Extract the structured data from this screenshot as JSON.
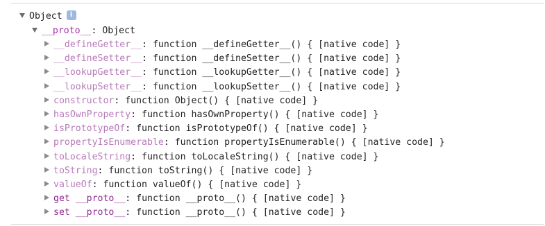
{
  "root": {
    "label": "Object",
    "info_icon": "i"
  },
  "proto": {
    "key": "__proto__",
    "value": "Object"
  },
  "properties": [
    {
      "key": "__defineGetter__",
      "value": "function __defineGetter__() { [native code] }"
    },
    {
      "key": "__defineSetter__",
      "value": "function __defineSetter__() { [native code] }"
    },
    {
      "key": "__lookupGetter__",
      "value": "function __lookupGetter__() { [native code] }"
    },
    {
      "key": "__lookupSetter__",
      "value": "function __lookupSetter__() { [native code] }"
    },
    {
      "key": "constructor",
      "value": "function Object() { [native code] }"
    },
    {
      "key": "hasOwnProperty",
      "value": "function hasOwnProperty() { [native code] }"
    },
    {
      "key": "isPrototypeOf",
      "value": "function isPrototypeOf() { [native code] }"
    },
    {
      "key": "propertyIsEnumerable",
      "value": "function propertyIsEnumerable() { [native code] }"
    },
    {
      "key": "toLocaleString",
      "value": "function toLocaleString() { [native code] }"
    },
    {
      "key": "toString",
      "value": "function toString() { [native code] }"
    },
    {
      "key": "valueOf",
      "value": "function valueOf() { [native code] }"
    }
  ],
  "accessors": [
    {
      "kind": "get",
      "key": "__proto__",
      "value": "function __proto__() { [native code] }"
    },
    {
      "kind": "set",
      "key": "__proto__",
      "value": "function __proto__() { [native code] }"
    }
  ],
  "separator": ": ",
  "colors": {
    "key": "#a531a8",
    "key_dim": "#b77ab9",
    "text": "#222222",
    "triangle": "#6e6e6e",
    "info_badge": "#9fb8de"
  }
}
